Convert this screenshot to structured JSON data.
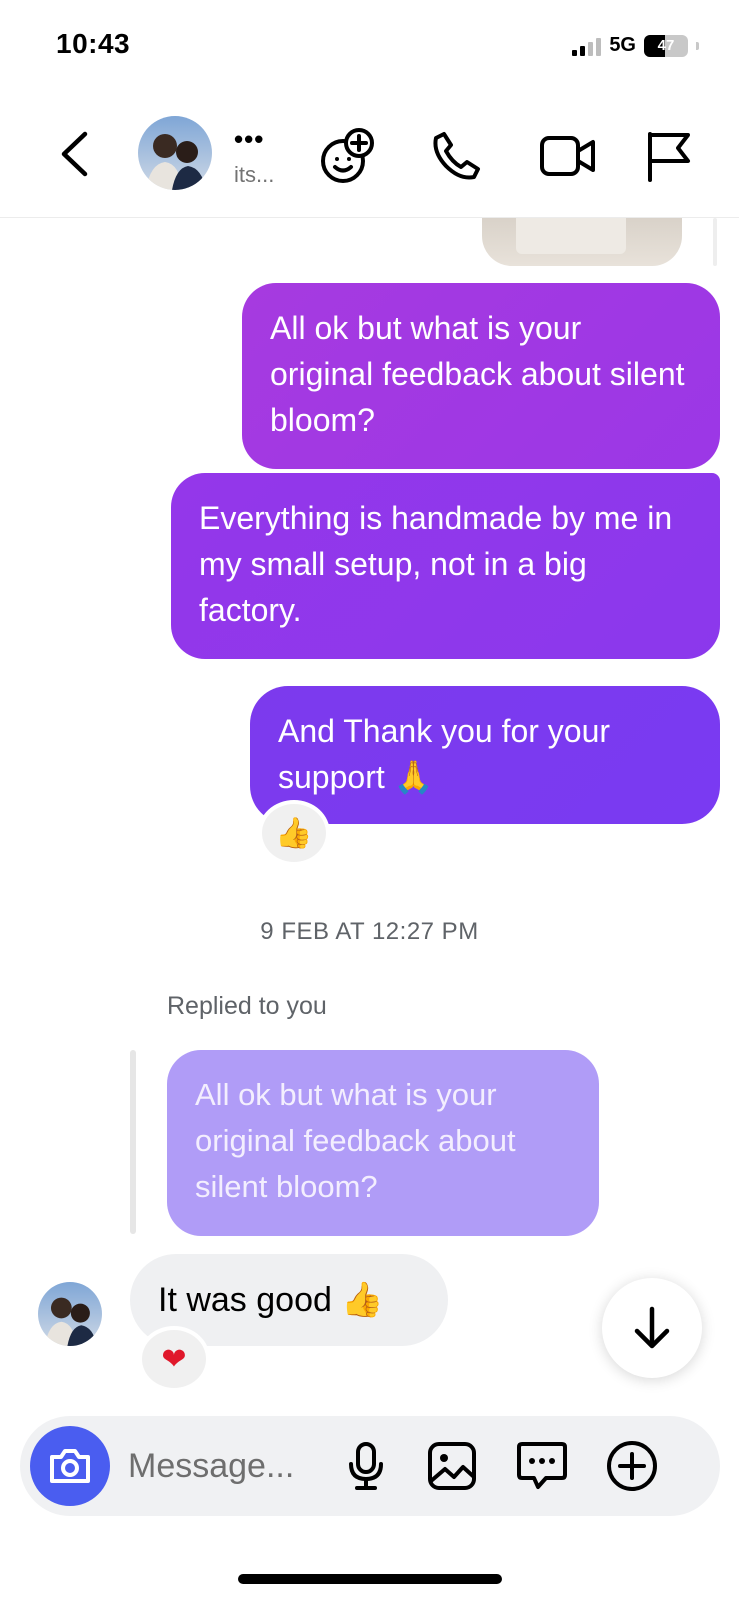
{
  "status_bar": {
    "time": "10:43",
    "network": "5G",
    "battery_level": "47"
  },
  "header": {
    "name": "•••",
    "subtitle": "its..."
  },
  "messages": {
    "outgoing": [
      {
        "text": "All ok but what is your original feedback about silent bloom?"
      },
      {
        "text": "Everything is handmade by me in my small setup, not in a big factory."
      },
      {
        "text": "And Thank you for your support",
        "emoji": "🙏"
      }
    ],
    "reaction_outgoing": "👍",
    "timestamp": "9 FEB AT 12:27 PM",
    "reply_label": "Replied to you",
    "quoted_text": "All ok but what is your original feedback about silent bloom?",
    "incoming": {
      "text": "It was good",
      "emoji": "👍"
    },
    "reaction_incoming": "❤"
  },
  "composer": {
    "placeholder": "Message..."
  },
  "icons": {
    "back": "chevron-left-icon",
    "effects": "sticker-add-icon",
    "call": "phone-icon",
    "video": "video-icon",
    "report": "flag-icon",
    "camera": "camera-icon",
    "mic": "mic-icon",
    "gallery": "image-icon",
    "chat": "chat-bubble-icon",
    "plus": "plus-circle-icon",
    "scroll_down": "arrow-down-icon"
  },
  "colors": {
    "bubble_1": "#a63ae0",
    "bubble_2": "#8f38ea",
    "bubble_3": "#7b3aef",
    "reply_bubble": "#b09cf7",
    "incoming_bubble": "#eff0f2",
    "camera_button": "#4a5df0"
  }
}
